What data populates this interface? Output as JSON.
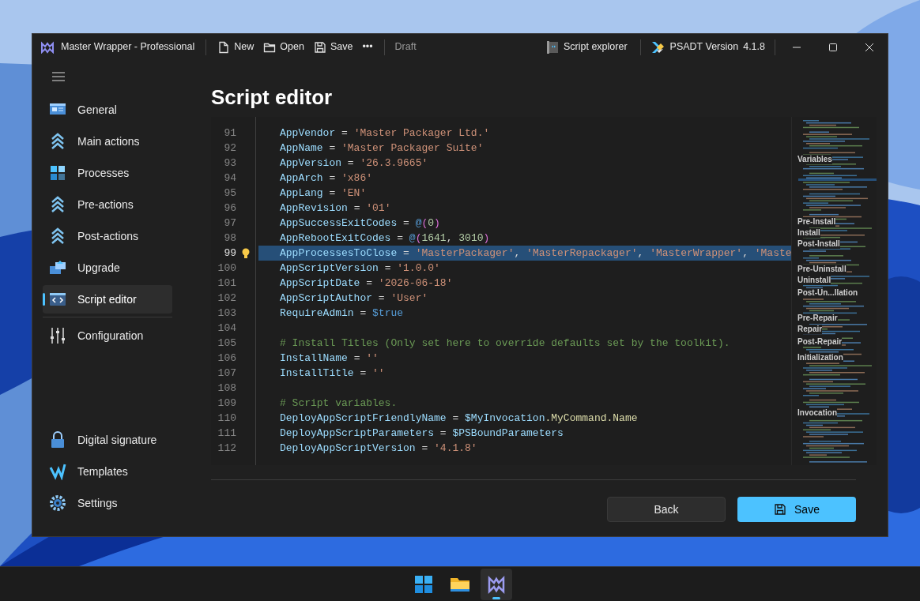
{
  "window": {
    "title": "Master Wrapper - Professional",
    "toolbar": [
      {
        "label": "New",
        "kind": "file"
      },
      {
        "label": "Open",
        "kind": "folder"
      },
      {
        "label": "Save",
        "kind": "save"
      },
      {
        "label": "•••",
        "kind": "more"
      }
    ],
    "status": "Draft",
    "script_explorer": "Script explorer",
    "psadt_label": "PSADT Version",
    "psadt_version": "4.1.8"
  },
  "sidebar": {
    "items": [
      {
        "label": "General",
        "kind": "general",
        "selected": false
      },
      {
        "label": "Main actions",
        "kind": "chevrons",
        "selected": false
      },
      {
        "label": "Processes",
        "kind": "processes",
        "selected": false
      },
      {
        "label": "Pre-actions",
        "kind": "chevrons",
        "selected": false
      },
      {
        "label": "Post-actions",
        "kind": "chevrons",
        "selected": false
      },
      {
        "label": "Upgrade",
        "kind": "upgrade",
        "selected": false
      },
      {
        "label": "Script editor",
        "kind": "code",
        "selected": true
      },
      {
        "label": "Configuration",
        "kind": "sliders",
        "selected": false
      }
    ],
    "bottom_items": [
      {
        "label": "Digital signature",
        "kind": "lock",
        "selected": false
      },
      {
        "label": "Templates",
        "kind": "templates",
        "selected": false
      },
      {
        "label": "Settings",
        "kind": "gear",
        "selected": false
      }
    ]
  },
  "page_title": "Script editor",
  "editor": {
    "lines": [
      {
        "number": "91",
        "selected": false,
        "tokens": [
          {
            "text": "AppVendor",
            "kind": "var"
          },
          {
            "text": " = ",
            "kind": "op"
          },
          {
            "text": "'Master Packager Ltd.'",
            "kind": "str"
          }
        ]
      },
      {
        "number": "92",
        "selected": false,
        "tokens": [
          {
            "text": "AppName",
            "kind": "var"
          },
          {
            "text": " = ",
            "kind": "op"
          },
          {
            "text": "'Master Packager Suite'",
            "kind": "str"
          }
        ]
      },
      {
        "number": "93",
        "selected": false,
        "tokens": [
          {
            "text": "AppVersion",
            "kind": "var"
          },
          {
            "text": " = ",
            "kind": "op"
          },
          {
            "text": "'26.3.9665'",
            "kind": "str"
          }
        ]
      },
      {
        "number": "94",
        "selected": false,
        "tokens": [
          {
            "text": "AppArch",
            "kind": "var"
          },
          {
            "text": " = ",
            "kind": "op"
          },
          {
            "text": "'x86'",
            "kind": "str"
          }
        ]
      },
      {
        "number": "95",
        "selected": false,
        "tokens": [
          {
            "text": "AppLang",
            "kind": "var"
          },
          {
            "text": " = ",
            "kind": "op"
          },
          {
            "text": "'EN'",
            "kind": "str"
          }
        ]
      },
      {
        "number": "96",
        "selected": false,
        "tokens": [
          {
            "text": "AppRevision",
            "kind": "var"
          },
          {
            "text": " = ",
            "kind": "op"
          },
          {
            "text": "'01'",
            "kind": "str"
          }
        ]
      },
      {
        "number": "97",
        "selected": false,
        "tokens": [
          {
            "text": "AppSuccessExitCodes",
            "kind": "var"
          },
          {
            "text": " = ",
            "kind": "op"
          },
          {
            "text": "@",
            "kind": "kw"
          },
          {
            "text": "(",
            "kind": "paren"
          },
          {
            "text": "0",
            "kind": "num"
          },
          {
            "text": ")",
            "kind": "paren"
          }
        ]
      },
      {
        "number": "98",
        "selected": false,
        "tokens": [
          {
            "text": "AppRebootExitCodes",
            "kind": "var"
          },
          {
            "text": " = ",
            "kind": "op"
          },
          {
            "text": "@",
            "kind": "kw"
          },
          {
            "text": "(",
            "kind": "paren"
          },
          {
            "text": "1641",
            "kind": "num"
          },
          {
            "text": ", ",
            "kind": "op"
          },
          {
            "text": "3010",
            "kind": "num"
          },
          {
            "text": ")",
            "kind": "paren"
          }
        ]
      },
      {
        "number": "99",
        "selected": true,
        "tokens": [
          {
            "text": "AppProcessesToClose",
            "kind": "var"
          },
          {
            "text": " = ",
            "kind": "op"
          },
          {
            "text": "'MasterPackager'",
            "kind": "str"
          },
          {
            "text": ", ",
            "kind": "op"
          },
          {
            "text": "'MasterRepackager'",
            "kind": "str"
          },
          {
            "text": ", ",
            "kind": "op"
          },
          {
            "text": "'MasterWrapper'",
            "kind": "str"
          },
          {
            "text": ", ",
            "kind": "op"
          },
          {
            "text": "'Maste",
            "kind": "str"
          }
        ]
      },
      {
        "number": "100",
        "selected": false,
        "tokens": [
          {
            "text": "AppScriptVersion",
            "kind": "var"
          },
          {
            "text": " = ",
            "kind": "op"
          },
          {
            "text": "'1.0.0'",
            "kind": "str"
          }
        ]
      },
      {
        "number": "101",
        "selected": false,
        "tokens": [
          {
            "text": "AppScriptDate",
            "kind": "var"
          },
          {
            "text": " = ",
            "kind": "op"
          },
          {
            "text": "'2026-06-18'",
            "kind": "str"
          }
        ]
      },
      {
        "number": "102",
        "selected": false,
        "tokens": [
          {
            "text": "AppScriptAuthor",
            "kind": "var"
          },
          {
            "text": " = ",
            "kind": "op"
          },
          {
            "text": "'User'",
            "kind": "str"
          }
        ]
      },
      {
        "number": "103",
        "selected": false,
        "tokens": [
          {
            "text": "RequireAdmin",
            "kind": "var"
          },
          {
            "text": " = ",
            "kind": "op"
          },
          {
            "text": "$true",
            "kind": "kw"
          }
        ]
      },
      {
        "number": "104",
        "selected": false
      },
      {
        "number": "105",
        "selected": false,
        "tokens": [
          {
            "text": "# Install Titles (Only set here to override defaults set by the toolkit).",
            "kind": "comment"
          }
        ]
      },
      {
        "number": "106",
        "selected": false,
        "tokens": [
          {
            "text": "InstallName",
            "kind": "var"
          },
          {
            "text": " = ",
            "kind": "op"
          },
          {
            "text": "''",
            "kind": "str"
          }
        ]
      },
      {
        "number": "107",
        "selected": false,
        "tokens": [
          {
            "text": "InstallTitle",
            "kind": "var"
          },
          {
            "text": " = ",
            "kind": "op"
          },
          {
            "text": "''",
            "kind": "str"
          }
        ]
      },
      {
        "number": "108",
        "selected": false
      },
      {
        "number": "109",
        "selected": false,
        "tokens": [
          {
            "text": "# Script variables.",
            "kind": "comment"
          }
        ]
      },
      {
        "number": "110",
        "selected": false,
        "tokens": [
          {
            "text": "DeployAppScriptFriendlyName",
            "kind": "var"
          },
          {
            "text": " = ",
            "kind": "op"
          },
          {
            "text": "$MyInvocation",
            "kind": "var"
          },
          {
            "text": ".MyCommand.Name",
            "kind": "member"
          }
        ]
      },
      {
        "number": "111",
        "selected": false,
        "tokens": [
          {
            "text": "DeployAppScriptParameters",
            "kind": "var"
          },
          {
            "text": " = ",
            "kind": "op"
          },
          {
            "text": "$PSBoundParameters",
            "kind": "var"
          }
        ]
      },
      {
        "number": "112",
        "selected": false,
        "tokens": [
          {
            "text": "DeployAppScriptVersion",
            "kind": "var"
          },
          {
            "text": " = ",
            "kind": "op"
          },
          {
            "text": "'4.1.8'",
            "kind": "str"
          }
        ]
      }
    ],
    "minimap_sections": [
      "Variables",
      "Pre-Install",
      "Install",
      "Post-Install",
      "Pre-Uninstall",
      "Uninstall",
      "Post-Un...llation",
      "Pre-Repair",
      "Repair",
      "Post-Repair",
      "Initialization",
      "Invocation"
    ]
  },
  "buttons": [
    {
      "label": "Back",
      "kind": "secondary"
    },
    {
      "label": "Save",
      "kind": "primary"
    }
  ],
  "taskbar": [
    {
      "kind": "start",
      "active": false
    },
    {
      "kind": "folder",
      "active": false
    },
    {
      "kind": "app",
      "active": true
    }
  ]
}
